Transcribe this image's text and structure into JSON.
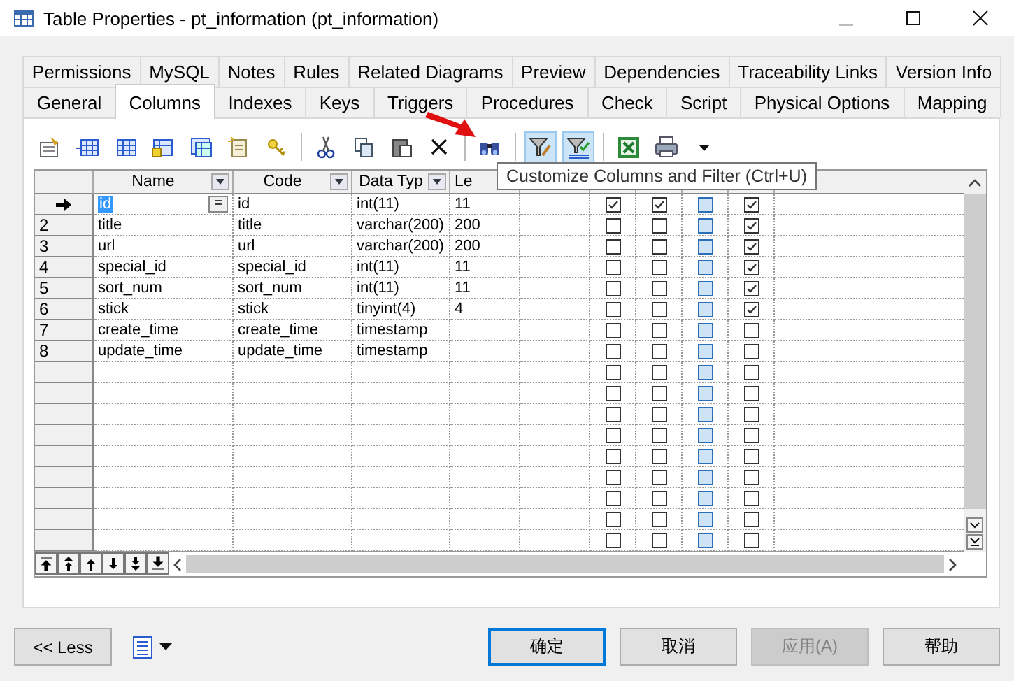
{
  "window": {
    "title": "Table Properties - pt_information (pt_information)"
  },
  "tabs": [
    [
      {
        "label": "Permissions",
        "selected": false
      },
      {
        "label": "MySQL",
        "selected": false
      },
      {
        "label": "Notes",
        "selected": false
      },
      {
        "label": "Rules",
        "selected": false
      },
      {
        "label": "Related Diagrams",
        "selected": false
      },
      {
        "label": "Preview",
        "selected": false
      },
      {
        "label": "Dependencies",
        "selected": false
      },
      {
        "label": "Traceability Links",
        "selected": false
      },
      {
        "label": "Version Info",
        "selected": false
      }
    ],
    [
      {
        "label": "General",
        "selected": false
      },
      {
        "label": "Columns",
        "selected": true
      },
      {
        "label": "Indexes",
        "selected": false
      },
      {
        "label": "Keys",
        "selected": false
      },
      {
        "label": "Triggers",
        "selected": false
      },
      {
        "label": "Procedures",
        "selected": false
      },
      {
        "label": "Check",
        "selected": false
      },
      {
        "label": "Script",
        "selected": false
      },
      {
        "label": "Physical Options",
        "selected": false
      },
      {
        "label": "Mapping",
        "selected": false
      }
    ]
  ],
  "table": {
    "columns": [
      "Name",
      "Code",
      "Data Typ",
      "Le"
    ],
    "check_columns": [
      {
        "disabled": false
      },
      {
        "disabled": false
      },
      {
        "disabled": true
      },
      {
        "disabled": false
      }
    ],
    "rows": [
      {
        "current": true,
        "name": "id",
        "name_selected": true,
        "name_button": "=",
        "code": "id",
        "type": "int(11)",
        "length": "11",
        "checks": [
          true,
          true,
          false,
          true
        ]
      },
      {
        "current": false,
        "number": "2",
        "name": "title",
        "name_selected": false,
        "code": "title",
        "type": "varchar(200)",
        "length": "200",
        "checks": [
          false,
          false,
          false,
          true
        ]
      },
      {
        "current": false,
        "number": "3",
        "name": "url",
        "name_selected": false,
        "code": "url",
        "type": "varchar(200)",
        "length": "200",
        "checks": [
          false,
          false,
          false,
          true
        ]
      },
      {
        "current": false,
        "number": "4",
        "name": "special_id",
        "name_selected": false,
        "code": "special_id",
        "type": "int(11)",
        "length": "11",
        "checks": [
          false,
          false,
          false,
          true
        ]
      },
      {
        "current": false,
        "number": "5",
        "name": "sort_num",
        "name_selected": false,
        "code": "sort_num",
        "type": "int(11)",
        "length": "11",
        "checks": [
          false,
          false,
          false,
          true
        ]
      },
      {
        "current": false,
        "number": "6",
        "name": "stick",
        "name_selected": false,
        "code": "stick",
        "type": "tinyint(4)",
        "length": "4",
        "checks": [
          false,
          false,
          false,
          true
        ]
      },
      {
        "current": false,
        "number": "7",
        "name": "create_time",
        "name_selected": false,
        "code": "create_time",
        "type": "timestamp",
        "checks": [
          false,
          false,
          false,
          false
        ]
      },
      {
        "current": false,
        "number": "8",
        "name": "update_time",
        "name_selected": false,
        "code": "update_time",
        "type": "timestamp",
        "checks": [
          false,
          false,
          false,
          false
        ]
      },
      {
        "checks": [
          false,
          false,
          false,
          false
        ]
      },
      {
        "checks": [
          false,
          false,
          false,
          false
        ]
      },
      {
        "checks": [
          false,
          false,
          false,
          false
        ]
      },
      {
        "checks": [
          false,
          false,
          false,
          false
        ]
      },
      {
        "checks": [
          false,
          false,
          false,
          false
        ]
      },
      {
        "checks": [
          false,
          false,
          false,
          false
        ]
      },
      {
        "checks": [
          false,
          false,
          false,
          false
        ]
      },
      {
        "checks": [
          false,
          false,
          false,
          false
        ]
      },
      {
        "checks": [
          false,
          false,
          false,
          false
        ]
      }
    ]
  },
  "tooltip": "Customize Columns and Filter (Ctrl+U)",
  "buttons": [
    {
      "label": "<< Less",
      "kind": "normal"
    },
    {
      "label": "确定",
      "kind": "default"
    },
    {
      "label": "取消",
      "kind": "normal"
    },
    {
      "label": "应用(A)",
      "kind": "disabled"
    },
    {
      "label": "帮助",
      "kind": "normal"
    }
  ]
}
